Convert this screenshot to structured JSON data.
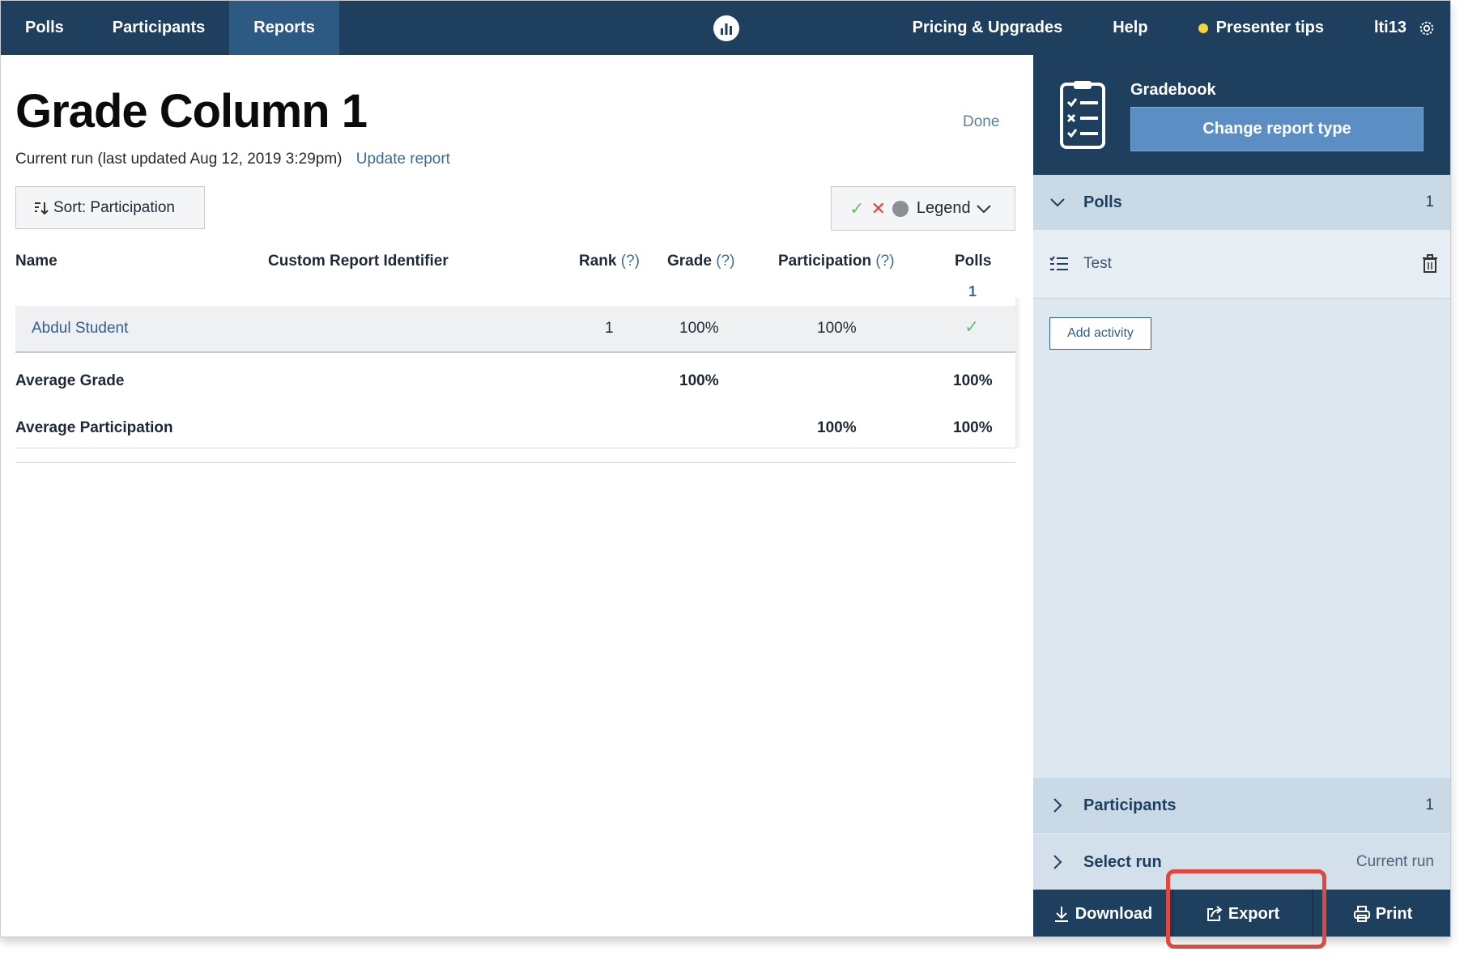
{
  "topnav": {
    "tabs": [
      "Polls",
      "Participants",
      "Reports"
    ],
    "links": {
      "pricing": "Pricing & Upgrades",
      "help": "Help",
      "tips": "Presenter tips",
      "user": "lti13"
    }
  },
  "main": {
    "title": "Grade Column 1",
    "done": "Done",
    "run_text": "Current run (last updated Aug 12, 2019 3:29pm)",
    "update_link": "Update report",
    "sort_label": "Sort: Participation",
    "legend_label": "Legend"
  },
  "table": {
    "headers": {
      "name": "Name",
      "identifier": "Custom Report Identifier",
      "rank": "Rank",
      "grade": "Grade",
      "participation": "Participation",
      "polls": "Polls",
      "help_mark": "(?)",
      "polls_count": "1"
    },
    "row": {
      "name": "Abdul Student",
      "rank": "1",
      "grade": "100%",
      "participation": "100%",
      "polls": "✓"
    },
    "avg_grade": {
      "label": "Average Grade",
      "grade": "100%",
      "polls": "100%"
    },
    "avg_participation": {
      "label": "Average Participation",
      "participation": "100%",
      "polls": "100%"
    }
  },
  "side": {
    "title": "Gradebook",
    "change_btn": "Change report type",
    "polls_section": {
      "label": "Polls",
      "count": "1"
    },
    "poll_item": "Test",
    "add_activity": "Add activity",
    "participants_section": {
      "label": "Participants",
      "count": "1"
    },
    "select_run": {
      "label": "Select run",
      "value": "Current run"
    },
    "footer": {
      "download": "Download",
      "export": "Export",
      "print": "Print"
    }
  },
  "colors": {
    "nav_bg": "#1e3f5e",
    "accent_blue": "#5b8fc4",
    "highlight_red": "#e0473e",
    "check_green": "#6cbf7a"
  }
}
